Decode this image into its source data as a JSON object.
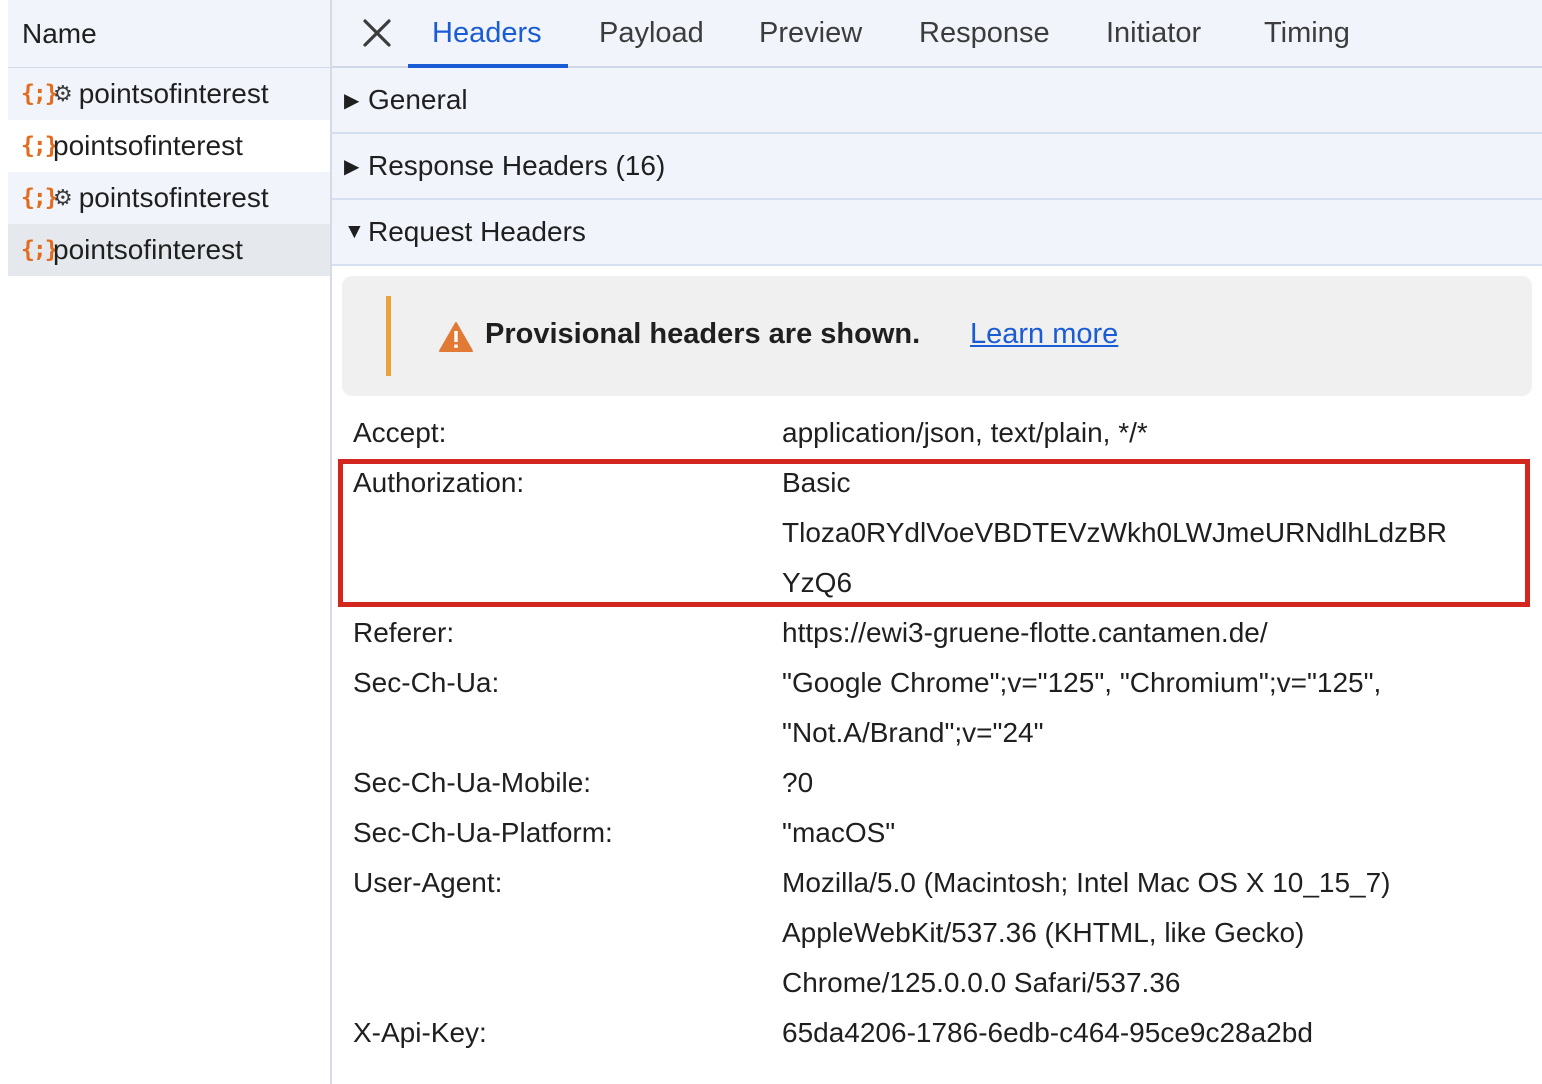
{
  "network_list": {
    "header": "Name",
    "rows": [
      {
        "icon": "json-icon",
        "has_gear": true,
        "name": "pointsofinterest"
      },
      {
        "icon": "json-icon",
        "has_gear": false,
        "name": "pointsofinterest"
      },
      {
        "icon": "json-icon",
        "has_gear": true,
        "name": "pointsofinterest"
      },
      {
        "icon": "json-icon",
        "has_gear": false,
        "name": "pointsofinterest",
        "selected": true
      }
    ],
    "json_icon_glyph": "{;}",
    "gear_icon_glyph": "⚙"
  },
  "tabs": [
    {
      "label": "Headers",
      "active": true
    },
    {
      "label": "Payload"
    },
    {
      "label": "Preview"
    },
    {
      "label": "Response"
    },
    {
      "label": "Initiator"
    },
    {
      "label": "Timing"
    }
  ],
  "sections": {
    "general": "General",
    "response_headers": "Response Headers (16)",
    "request_headers": "Request Headers"
  },
  "notice": {
    "text": "Provisional headers are shown.",
    "link": "Learn more",
    "accent_color": "#e8a33b"
  },
  "request_headers": [
    {
      "name": "Accept:",
      "value_lines": [
        "application/json, text/plain, */*"
      ]
    },
    {
      "name": "Authorization:",
      "value_lines": [
        "Basic",
        "Tloza0RYdlVoeVBDTEVzWkh0LWJmeURNdlhLdzBR",
        "YzQ6"
      ],
      "highlighted": true
    },
    {
      "name": "Referer:",
      "value_lines": [
        "https://ewi3-gruene-flotte.cantamen.de/"
      ]
    },
    {
      "name": "Sec-Ch-Ua:",
      "value_lines": [
        "\"Google Chrome\";v=\"125\", \"Chromium\";v=\"125\",",
        "\"Not.A/Brand\";v=\"24\""
      ]
    },
    {
      "name": "Sec-Ch-Ua-Mobile:",
      "value_lines": [
        "?0"
      ]
    },
    {
      "name": "Sec-Ch-Ua-Platform:",
      "value_lines": [
        "\"macOS\""
      ]
    },
    {
      "name": "User-Agent:",
      "value_lines": [
        "Mozilla/5.0 (Macintosh; Intel Mac OS X 10_15_7)",
        "AppleWebKit/537.36 (KHTML, like Gecko)",
        "Chrome/125.0.0.0 Safari/537.36"
      ]
    },
    {
      "name": "X-Api-Key:",
      "value_lines": [
        "65da4206-1786-6edb-c464-95ce9c28a2bd"
      ]
    }
  ],
  "colors": {
    "accent_blue": "#1a5cd4",
    "highlight_red": "#d3261f",
    "json_icon_orange": "#e26b1d",
    "warning_orange": "#e07a34"
  }
}
